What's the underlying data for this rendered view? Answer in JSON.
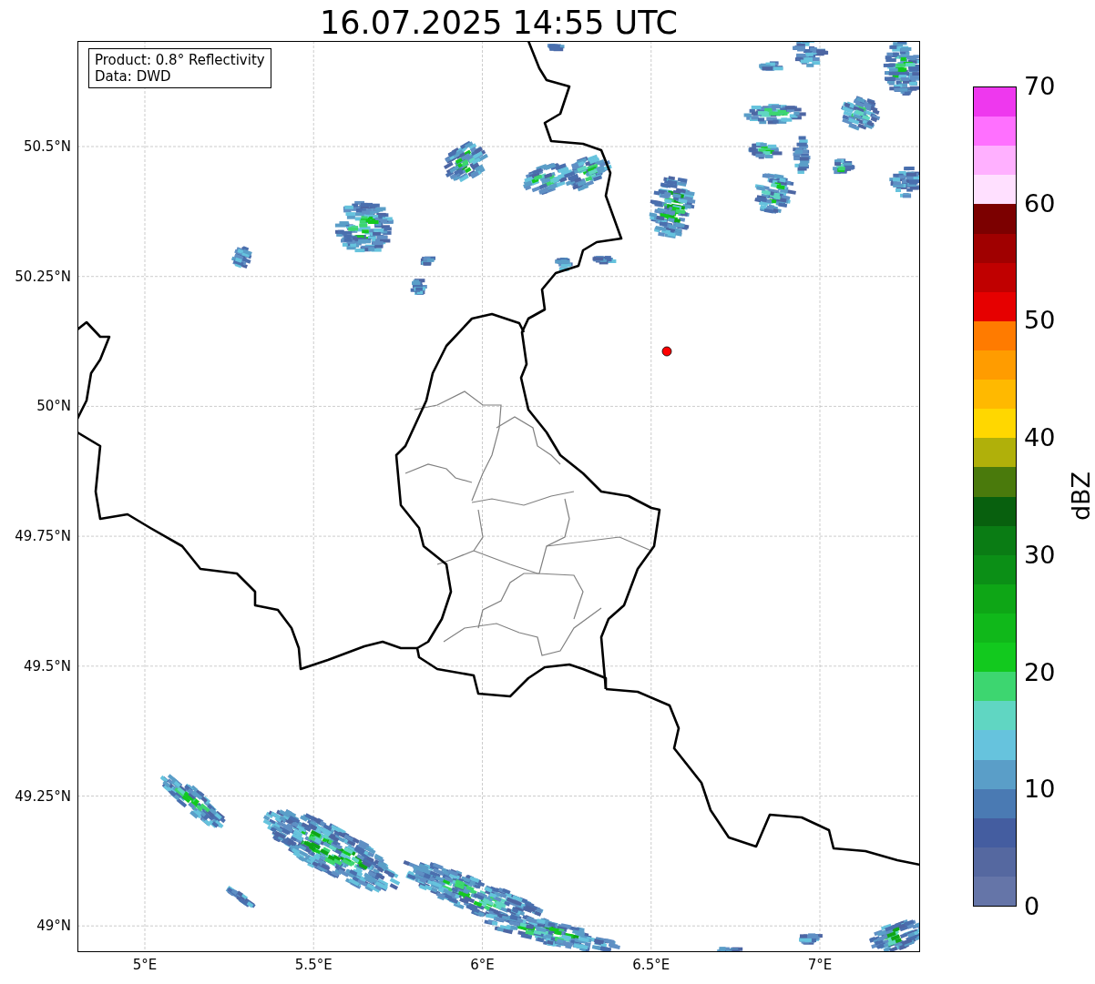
{
  "title": "16.07.2025 14:55 UTC",
  "info_box": [
    "Product: 0.8° Reflectivity",
    "Data: DWD"
  ],
  "map": {
    "y_ticks": [
      "50.5°N",
      "50.25°N",
      "50°N",
      "49.75°N",
      "49.5°N",
      "49.25°N",
      "49°N"
    ],
    "x_ticks": [
      "5°E",
      "5.5°E",
      "6°E",
      "6.5°E",
      "7°E"
    ]
  },
  "colorbar": {
    "label": "dBZ",
    "ticks": [
      "70",
      "60",
      "50",
      "40",
      "30",
      "20",
      "10",
      "0"
    ],
    "segments": [
      {
        "color": "#ee38ee"
      },
      {
        "color": "#ff70ff"
      },
      {
        "color": "#ffb0ff"
      },
      {
        "color": "#ffe0ff"
      },
      {
        "color": "#7c0000"
      },
      {
        "color": "#a00000"
      },
      {
        "color": "#c00000"
      },
      {
        "color": "#e60000"
      },
      {
        "color": "#ff7b00"
      },
      {
        "color": "#ff9c00"
      },
      {
        "color": "#ffb900"
      },
      {
        "color": "#ffd700"
      },
      {
        "color": "#b0b00a"
      },
      {
        "color": "#4a7a0c"
      },
      {
        "color": "#08600e"
      },
      {
        "color": "#0a7c14"
      },
      {
        "color": "#0b8f16"
      },
      {
        "color": "#0ea616"
      },
      {
        "color": "#10b81a"
      },
      {
        "color": "#12c91e"
      },
      {
        "color": "#3dd670"
      },
      {
        "color": "#60d6c2"
      },
      {
        "color": "#66c3dd"
      },
      {
        "color": "#5a9ec8"
      },
      {
        "color": "#4a7ab3"
      },
      {
        "color": "#445da0"
      },
      {
        "color": "#5568a0"
      },
      {
        "color": "#6575a8"
      }
    ]
  }
}
